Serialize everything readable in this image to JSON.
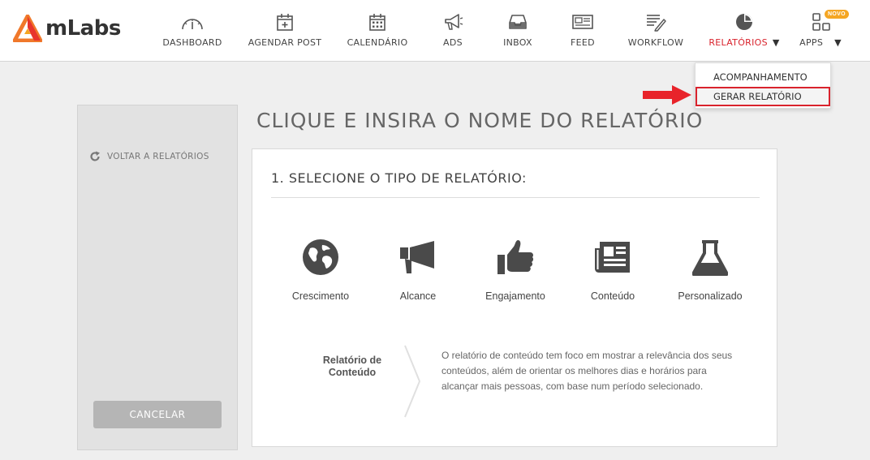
{
  "brand": {
    "name": "mLabs"
  },
  "nav": {
    "items": [
      {
        "key": "dashboard",
        "label": "DASHBOARD"
      },
      {
        "key": "agendar",
        "label": "AGENDAR POST"
      },
      {
        "key": "calendario",
        "label": "CALENDÁRIO"
      },
      {
        "key": "ads",
        "label": "ADS"
      },
      {
        "key": "inbox",
        "label": "INBOX"
      },
      {
        "key": "feed",
        "label": "FEED"
      },
      {
        "key": "workflow",
        "label": "WORKFLOW"
      },
      {
        "key": "relatorios",
        "label": "RELATÓRIOS"
      },
      {
        "key": "apps",
        "label": "APPS"
      }
    ],
    "apps_badge": "NOVO",
    "active": "relatorios",
    "active_color": "#d9232d"
  },
  "dropdown": {
    "items": [
      "ACOMPANHAMENTO",
      "GERAR RELATÓRIO"
    ],
    "highlighted": "GERAR RELATÓRIO",
    "highlight_color": "#d9232d"
  },
  "sidebar": {
    "back_label": "VOLTAR A RELATÓRIOS",
    "cancel_label": "CANCELAR"
  },
  "page": {
    "title": "CLIQUE E INSIRA O NOME DO RELATÓRIO",
    "section_title": "1. SELECIONE O TIPO DE RELATÓRIO:"
  },
  "report_types": [
    {
      "label": "Crescimento",
      "icon": "globe-icon"
    },
    {
      "label": "Alcance",
      "icon": "megaphone-icon"
    },
    {
      "label": "Engajamento",
      "icon": "thumbs-up-icon"
    },
    {
      "label": "Conteúdo",
      "icon": "newspaper-icon"
    },
    {
      "label": "Personalizado",
      "icon": "flask-icon"
    }
  ],
  "description": {
    "title": "Relatório de Conteúdo",
    "text": "O relatório de conteúdo tem foco em mostrar a relevância dos seus conteúdos, além de orientar os melhores dias e horários para alcançar mais pessoas, com base num período selecionado."
  }
}
